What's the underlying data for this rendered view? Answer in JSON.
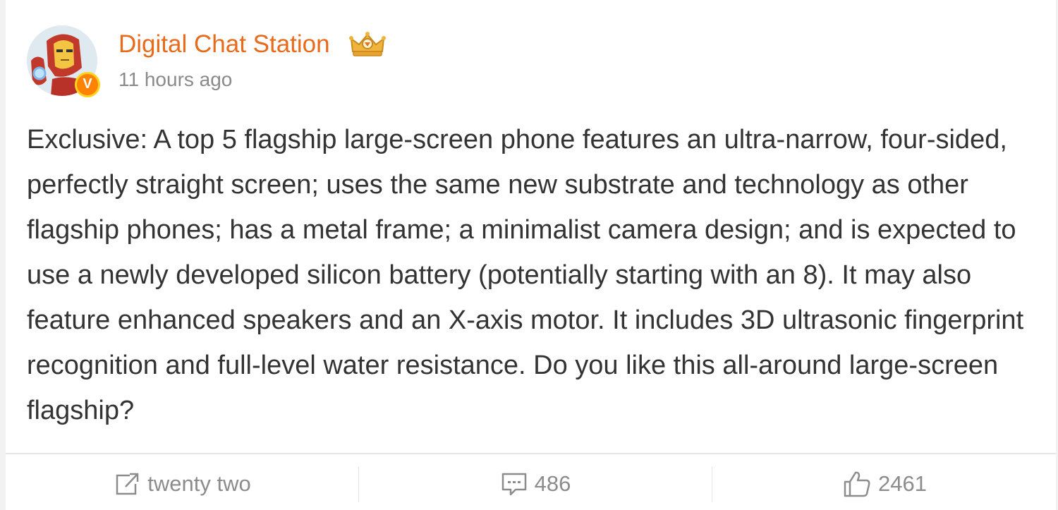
{
  "post": {
    "author": "Digital Chat Station",
    "time": "11 hours ago",
    "verified_badge": "V",
    "text": "Exclusive: A top 5 flagship large-screen phone features an ultra-narrow, four-sided, perfectly straight screen; uses the same new substrate and technology as other flagship phones; has a metal frame; a minimalist camera design; and is expected to use a newly developed silicon battery (potentially starting with an 8). It may also feature enhanced speakers and an X-axis motor. It includes 3D ultrasonic fingerprint recognition and full-level water resistance. Do you like this all-around large-screen flagship?"
  },
  "actions": {
    "repost_label": "twenty two",
    "comments_label": "486",
    "likes_label": "2461"
  },
  "icons": {
    "avatar": "iron-man-avatar",
    "crown": "crown-icon",
    "repost": "share-icon",
    "comment": "comment-icon",
    "like": "thumbs-up-icon"
  },
  "colors": {
    "author_name": "#e86b1c",
    "text": "#333333",
    "muted": "#8a8a8a",
    "badge": "#ff8200"
  }
}
